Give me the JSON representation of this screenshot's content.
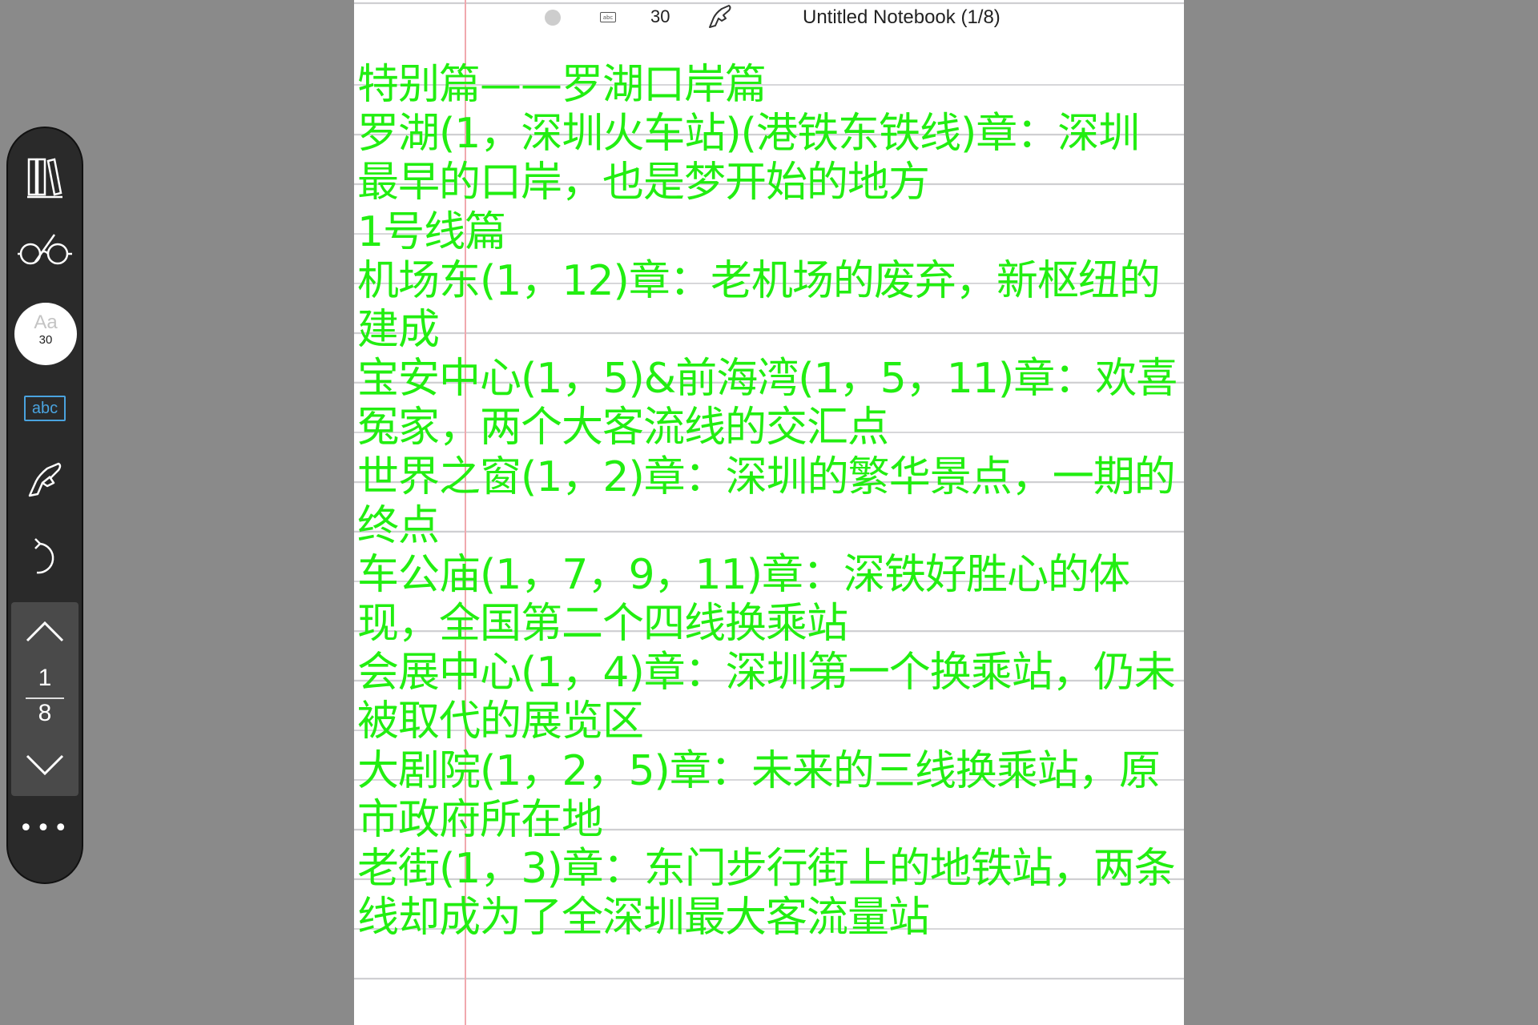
{
  "header": {
    "font_size": "30",
    "title": "Untitled Notebook (1/8)"
  },
  "toolbar": {
    "font_button": {
      "aa": "Aa",
      "size": "30"
    },
    "text_tool_label": "abc",
    "pager": {
      "current": "1",
      "total": "8"
    },
    "more_label": "•••"
  },
  "content": {
    "ink_color": "#22ee11",
    "lines": [
      "特别篇——罗湖口岸篇",
      "罗湖(1，深圳火车站)(港铁东铁线)章：深圳",
      "最早的口岸，也是梦开始的地方",
      "1号线篇",
      "机场东(1，12)章：老机场的废弃，新枢纽的",
      "建成",
      "宝安中心(1，5)&前海湾(1，5，11)章：欢喜",
      "冤家，两个大客流线的交汇点",
      "世界之窗(1，2)章：深圳的繁华景点，一期的",
      "终点",
      "车公庙(1，7，9，11)章：深铁好胜心的体",
      "现，全国第二个四线换乘站",
      "会展中心(1，4)章：深圳第一个换乘站，仍未",
      "被取代的展览区",
      "大剧院(1，2，5)章：未来的三线换乘站，原",
      "市政府所在地",
      "老街(1，3)章：东门步行街上的地铁站，两条",
      "线却成为了全深圳最大客流量站"
    ]
  }
}
